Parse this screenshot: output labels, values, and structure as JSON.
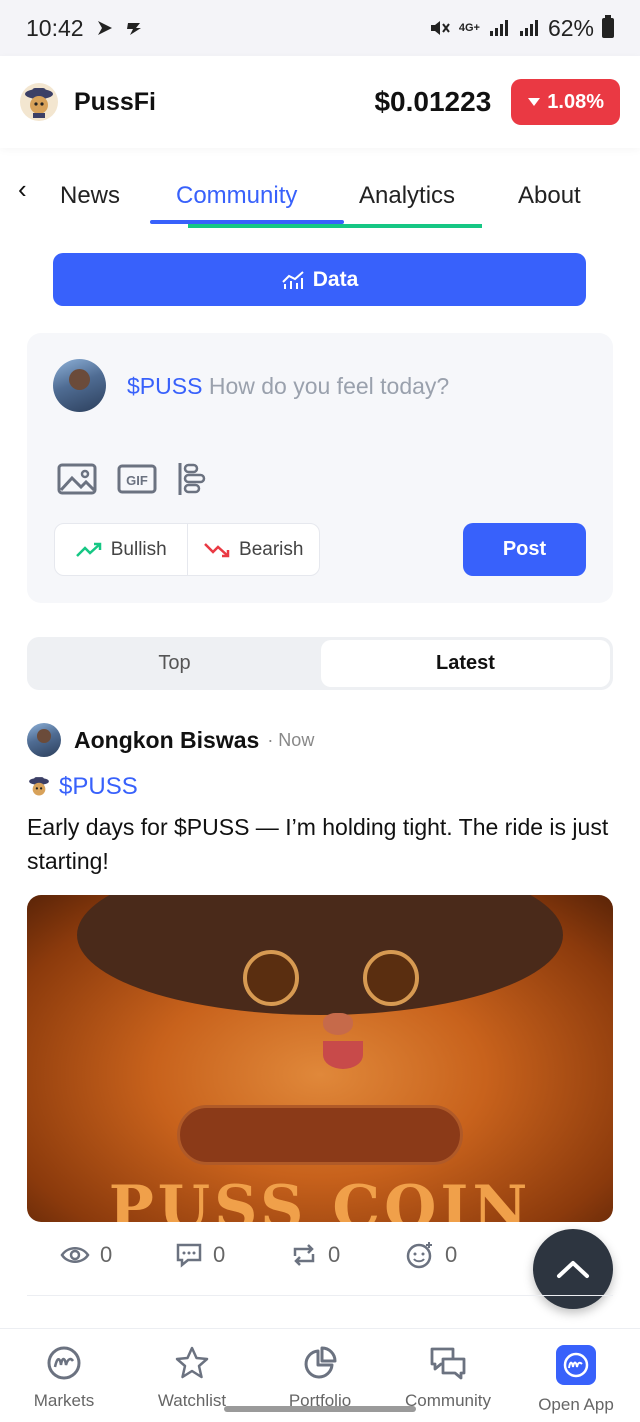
{
  "status_bar": {
    "time": "10:42",
    "network": "4G+",
    "battery": "62%"
  },
  "header": {
    "app_name": "PussFi",
    "price": "$0.01223",
    "change": "1.08%",
    "change_direction": "down",
    "change_color": "#ea3943"
  },
  "tabs": {
    "items": [
      "News",
      "Community",
      "Analytics",
      "About"
    ],
    "active": "Community"
  },
  "data_button": {
    "label": "Data"
  },
  "composer": {
    "ticker": "$PUSS",
    "placeholder": "How do you feel today?",
    "tools": [
      "image-icon",
      "gif-icon",
      "poll-icon"
    ],
    "bullish_label": "Bullish",
    "bearish_label": "Bearish",
    "post_label": "Post"
  },
  "feed_toggle": {
    "top_label": "Top",
    "latest_label": "Latest",
    "active": "Latest"
  },
  "post": {
    "author": "Aongkon Biswas",
    "time": "· Now",
    "ticker": "$PUSS",
    "text": "Early days for $PUSS — I’m holding tight. The ride is just starting!",
    "image_caption": "PUSS COIN",
    "stats": {
      "views": "0",
      "comments": "0",
      "reposts": "0",
      "reactions": "0"
    }
  },
  "bottom_nav": {
    "items": [
      "Markets",
      "Watchlist",
      "Portfolio",
      "Community",
      "Open App"
    ]
  },
  "colors": {
    "accent": "#3861fb",
    "bullish": "#16c784",
    "bearish": "#ea3943"
  }
}
